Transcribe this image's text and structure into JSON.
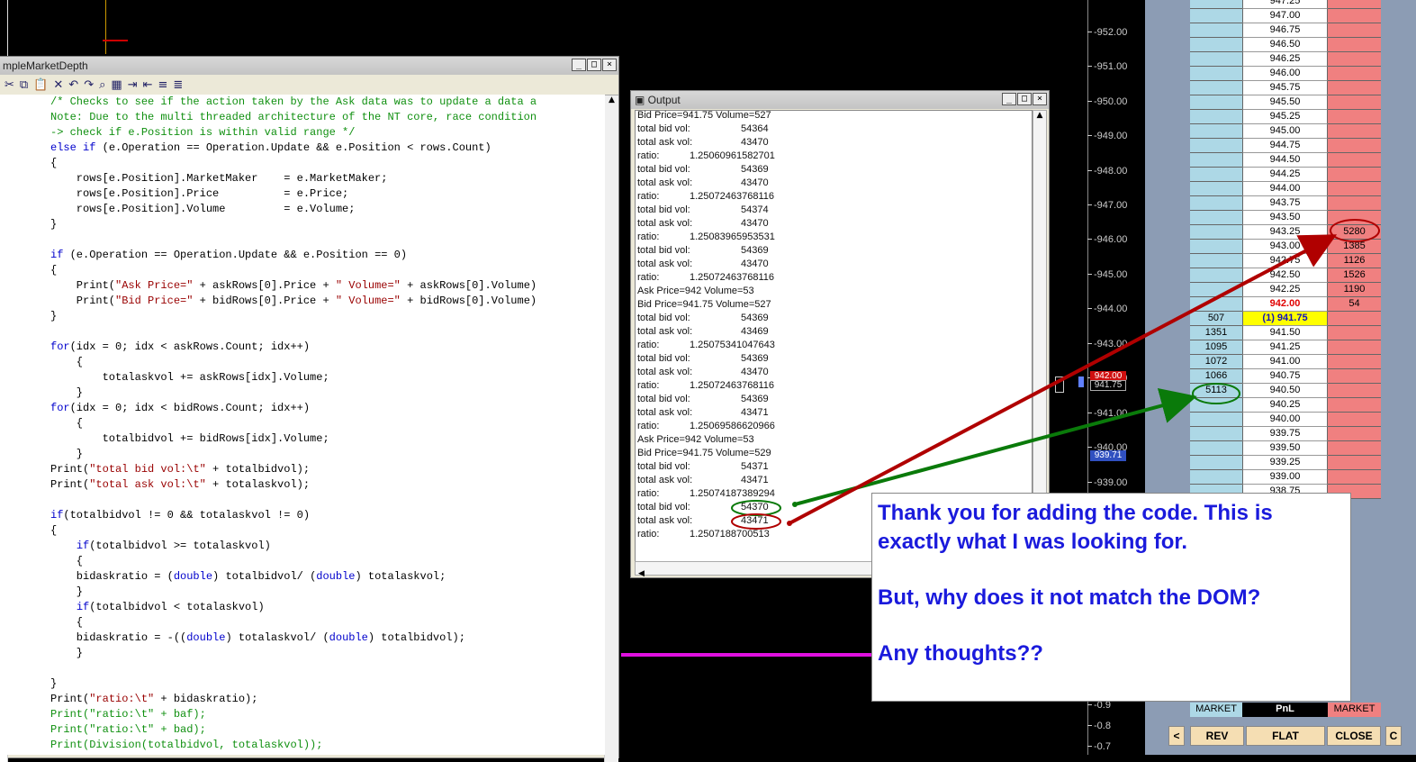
{
  "code_window": {
    "title": "mpleMarketDepth",
    "lines": [
      "    /* Checks to see if the action taken by the Ask data was to update a data a",
      "    Note: Due to the multi threaded architecture of the NT core, race condition",
      "    -> check if e.Position is within valid range */",
      "    else if (e.Operation == Operation.Update && e.Position < rows.Count)",
      "    {",
      "        rows[e.Position].MarketMaker    = e.MarketMaker;",
      "        rows[e.Position].Price          = e.Price;",
      "        rows[e.Position].Volume         = e.Volume;",
      "    }",
      "",
      "    if (e.Operation == Operation.Update && e.Position == 0)",
      "    {",
      "        Print(\"Ask Price=\" + askRows[0].Price + \" Volume=\" + askRows[0].Volume)",
      "        Print(\"Bid Price=\" + bidRows[0].Price + \" Volume=\" + bidRows[0].Volume)",
      "    }",
      "",
      "    for(idx = 0; idx < askRows.Count; idx++)",
      "        {",
      "            totalaskvol += askRows[idx].Volume;",
      "        }",
      "    for(idx = 0; idx < bidRows.Count; idx++)",
      "        {",
      "            totalbidvol += bidRows[idx].Volume;",
      "        }",
      "    Print(\"total bid vol:\\t\" + totalbidvol);",
      "    Print(\"total ask vol:\\t\" + totalaskvol);",
      "",
      "    if(totalbidvol != 0 && totalaskvol != 0)",
      "    {",
      "        if(totalbidvol >= totalaskvol)",
      "        {",
      "        bidaskratio = (double) totalbidvol/ (double) totalaskvol;",
      "        }",
      "        if(totalbidvol < totalaskvol)",
      "        {",
      "        bidaskratio = -((double) totalaskvol/ (double) totalbidvol);",
      "        }",
      "",
      "    }",
      "    Print(\"ratio:\\t\" + bidaskratio);",
      "    Print(\"ratio:\\t\" + baf);",
      "    Print(\"ratio:\\t\" + bad);",
      "    Print(Division(totalbidvol, totalaskvol));"
    ]
  },
  "output_window": {
    "title": "Output",
    "lines": [
      {
        "label": "Bid Price=941.75 Volume=527",
        "value": ""
      },
      {
        "label": "total bid vol:",
        "value": "54364"
      },
      {
        "label": "total ask vol:",
        "value": "43470"
      },
      {
        "label": "ratio:",
        "value": "1.25060961582701",
        "ratio": true
      },
      {
        "label": "total bid vol:",
        "value": "54369"
      },
      {
        "label": "total ask vol:",
        "value": "43470"
      },
      {
        "label": "ratio:",
        "value": "1.25072463768116",
        "ratio": true
      },
      {
        "label": "total bid vol:",
        "value": "54374"
      },
      {
        "label": "total ask vol:",
        "value": "43470"
      },
      {
        "label": "ratio:",
        "value": "1.25083965953531",
        "ratio": true
      },
      {
        "label": "total bid vol:",
        "value": "54369"
      },
      {
        "label": "total ask vol:",
        "value": "43470"
      },
      {
        "label": "ratio:",
        "value": "1.25072463768116",
        "ratio": true
      },
      {
        "label": "Ask Price=942 Volume=53",
        "value": ""
      },
      {
        "label": "Bid Price=941.75 Volume=527",
        "value": ""
      },
      {
        "label": "total bid vol:",
        "value": "54369"
      },
      {
        "label": "total ask vol:",
        "value": "43469"
      },
      {
        "label": "ratio:",
        "value": "1.25075341047643",
        "ratio": true
      },
      {
        "label": "total bid vol:",
        "value": "54369"
      },
      {
        "label": "total ask vol:",
        "value": "43470"
      },
      {
        "label": "ratio:",
        "value": "1.25072463768116",
        "ratio": true
      },
      {
        "label": "total bid vol:",
        "value": "54369"
      },
      {
        "label": "total ask vol:",
        "value": "43471"
      },
      {
        "label": "ratio:",
        "value": "1.25069586620966",
        "ratio": true
      },
      {
        "label": "Ask Price=942 Volume=53",
        "value": ""
      },
      {
        "label": "Bid Price=941.75 Volume=529",
        "value": ""
      },
      {
        "label": "total bid vol:",
        "value": "54371"
      },
      {
        "label": "total ask vol:",
        "value": "43471"
      },
      {
        "label": "ratio:",
        "value": "1.25074187389294",
        "ratio": true
      },
      {
        "label": "total bid vol:",
        "value": "54370"
      },
      {
        "label": "total ask vol:",
        "value": "43471"
      },
      {
        "label": "ratio:",
        "value": "1.2507188700513",
        "ratio": true
      }
    ]
  },
  "chart": {
    "y_ticks": [
      "952.00",
      "951.00",
      "950.00",
      "949.00",
      "948.00",
      "947.00",
      "946.00",
      "945.00",
      "944.00",
      "943.00",
      "942.00",
      "941.00",
      "940.00",
      "939.00",
      "0.9",
      "0.8",
      "0.7"
    ],
    "ask_marker": "942.00",
    "bid_marker": "941.75",
    "other_marker": "939.71"
  },
  "dom": {
    "rows": [
      {
        "bid": "",
        "price": "947.25",
        "ask": ""
      },
      {
        "bid": "",
        "price": "947.00",
        "ask": ""
      },
      {
        "bid": "",
        "price": "946.75",
        "ask": ""
      },
      {
        "bid": "",
        "price": "946.50",
        "ask": ""
      },
      {
        "bid": "",
        "price": "946.25",
        "ask": ""
      },
      {
        "bid": "",
        "price": "946.00",
        "ask": ""
      },
      {
        "bid": "",
        "price": "945.75",
        "ask": ""
      },
      {
        "bid": "",
        "price": "945.50",
        "ask": ""
      },
      {
        "bid": "",
        "price": "945.25",
        "ask": ""
      },
      {
        "bid": "",
        "price": "945.00",
        "ask": ""
      },
      {
        "bid": "",
        "price": "944.75",
        "ask": ""
      },
      {
        "bid": "",
        "price": "944.50",
        "ask": ""
      },
      {
        "bid": "",
        "price": "944.25",
        "ask": ""
      },
      {
        "bid": "",
        "price": "944.00",
        "ask": ""
      },
      {
        "bid": "",
        "price": "943.75",
        "ask": ""
      },
      {
        "bid": "",
        "price": "943.50",
        "ask": ""
      },
      {
        "bid": "",
        "price": "943.25",
        "ask": "5280"
      },
      {
        "bid": "",
        "price": "943.00",
        "ask": "1385"
      },
      {
        "bid": "",
        "price": "942.75",
        "ask": "1126"
      },
      {
        "bid": "",
        "price": "942.50",
        "ask": "1526"
      },
      {
        "bid": "",
        "price": "942.25",
        "ask": "1190"
      },
      {
        "bid": "",
        "price": "942.00",
        "ask": "54"
      },
      {
        "bid": "507",
        "price": "(1) 941.75",
        "ask": ""
      },
      {
        "bid": "1351",
        "price": "941.50",
        "ask": ""
      },
      {
        "bid": "1095",
        "price": "941.25",
        "ask": ""
      },
      {
        "bid": "1072",
        "price": "941.00",
        "ask": ""
      },
      {
        "bid": "1066",
        "price": "940.75",
        "ask": ""
      },
      {
        "bid": "5113",
        "price": "940.50",
        "ask": ""
      },
      {
        "bid": "",
        "price": "940.25",
        "ask": ""
      },
      {
        "bid": "",
        "price": "940.00",
        "ask": ""
      },
      {
        "bid": "",
        "price": "939.75",
        "ask": ""
      },
      {
        "bid": "",
        "price": "939.50",
        "ask": ""
      },
      {
        "bid": "",
        "price": "939.25",
        "ask": ""
      },
      {
        "bid": "",
        "price": "939.00",
        "ask": ""
      },
      {
        "bid": "",
        "price": "938.75",
        "ask": ""
      }
    ],
    "footer": {
      "bid": "MARKET",
      "price": "PnL",
      "ask": "MARKET"
    },
    "buttons": {
      "left": "<",
      "rev": "REV",
      "flat": "FLAT",
      "close": "CLOSE",
      "right": "C"
    }
  },
  "note": {
    "line1": "Thank you for adding the code.  This is exactly what I was looking for.",
    "line2": "But,  why does it not match the DOM?",
    "line3": "Any thoughts??"
  },
  "colors": {
    "green_annotation": "#0a7a0a",
    "red_annotation": "#b00000",
    "note_text": "#1a1adc"
  }
}
